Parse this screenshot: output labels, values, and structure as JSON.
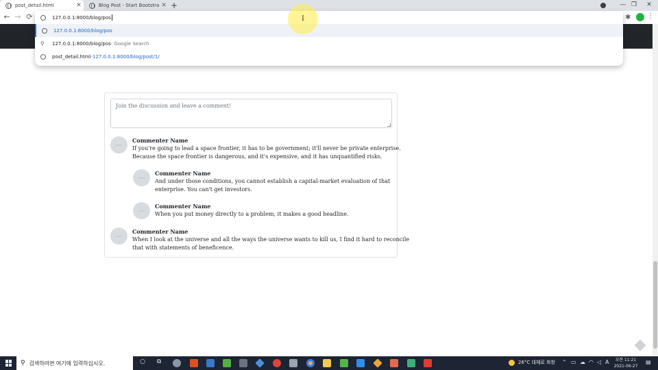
{
  "browser": {
    "tabs": [
      {
        "title": "post_detail.html",
        "active": true
      },
      {
        "title": "Blog Post - Start Bootstrap Ten",
        "active": false
      }
    ],
    "new_tab_label": "+",
    "window_controls": {
      "minimize": "—",
      "maximize": "❐",
      "close": "✕"
    },
    "nav": {
      "back": "←",
      "forward": "→",
      "reload": "⟳"
    },
    "address_value": "127.0.0.1:8000/blog/pos"
  },
  "omnibox": {
    "suggestions": [
      {
        "icon": "globe-icon",
        "text": "127.0.0.1:8000/blog/pos",
        "selected": true
      },
      {
        "icon": "search-icon",
        "text": "127.0.0.1:8000/blog/pos",
        "suffix": " - Google Search"
      },
      {
        "icon": "globe-icon",
        "text": "post_detail.html",
        "suffix": " - ",
        "url": "127.0.0.1:8000/blog/post/1/"
      }
    ]
  },
  "comments_section": {
    "placeholder": "Join the discussion and leave a comment!",
    "avatar_label": "50x50",
    "comments": [
      {
        "name": "Commenter Name",
        "lines": [
          "If you're going to lead a space frontier, it has to be government; it'll never be private enterprise.",
          "Because the space frontier is dangerous, and it's expensive, and it has unquantified risks."
        ]
      },
      {
        "name": "Commenter Name",
        "lines": [
          "And under those conditions, you cannot establish a capital-market evaluation of that",
          "enterprise. You can't get investors."
        ]
      },
      {
        "name": "Commenter Name",
        "lines": [
          "When you put money directly to a problem, it makes a good headline."
        ]
      },
      {
        "name": "Commenter Name",
        "lines": [
          "When I look at the universe and all the ways the universe wants to kill us, I find it hard to reconcile",
          "that with statements of beneficence."
        ]
      }
    ]
  },
  "taskbar": {
    "search_placeholder": "검색하려면 여기에 입력하십시오.",
    "weather": "26°C 대체로 화창",
    "ime": "A",
    "time": "오전 11:21",
    "date": "2021-06-27",
    "colors": {
      "bg": "#1d2433",
      "accent": "#1a73e8"
    }
  }
}
